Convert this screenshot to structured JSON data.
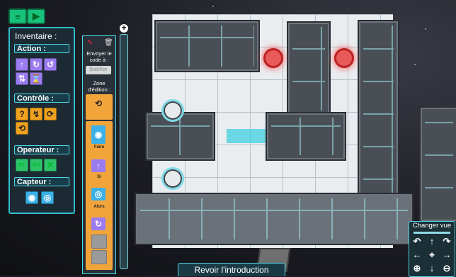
{
  "top_buttons": {
    "menu_icon": "hamburger-icon",
    "play_icon": "play-icon"
  },
  "inventory": {
    "title": "Inventaire :",
    "categories": {
      "action": "Action :",
      "controle": "Contrôle :",
      "operateur": "Operateur :",
      "capteur": "Capteur :"
    },
    "action_blocks": [
      "↑",
      "↻",
      "↺",
      "⇅",
      "⌛"
    ],
    "controle_blocks": [
      "?",
      "↯",
      "⟳",
      "⟲"
    ],
    "operateur_blocks": [
      "ET",
      "OU",
      "✕"
    ],
    "capteur_blocks": [
      "◉",
      "◎"
    ]
  },
  "editor": {
    "send_label": "Envoyer le code à :",
    "recipient_placeholder": "Bob/Kar",
    "zone_label": "Zone d'édition :",
    "faire_label": "Faire",
    "si_label": "Si",
    "alors_label": "Alors"
  },
  "buttons": {
    "intro": "Revoir l'introduction",
    "add": "+"
  },
  "camera": {
    "title": "Changer vue",
    "icons": [
      "rotate-left-icon",
      "arrow-up-icon",
      "rotate-right-icon",
      "arrow-left-icon",
      "location-pin-icon",
      "arrow-right-icon",
      "zoom-in-icon",
      "arrow-down-icon",
      "zoom-out-icon"
    ]
  },
  "colors": {
    "accent": "#4fd6e6",
    "action": "#9b7bf0",
    "controle": "#f0a21f",
    "operateur": "#2ec36a",
    "capteur": "#3bb1e8"
  }
}
